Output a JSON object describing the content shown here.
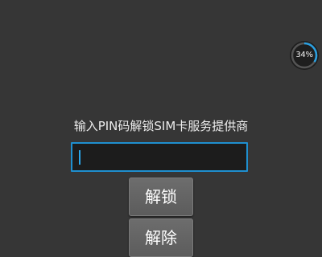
{
  "status_badge": {
    "value": "34%",
    "progress": 0.34,
    "ring_color": "#2a9fe0",
    "track_color": "#555555"
  },
  "pin_prompt": {
    "text": "输入PIN码解锁SIM卡服务提供商"
  },
  "pin_input": {
    "value": "",
    "placeholder": "",
    "border_color": "#1f8fcf"
  },
  "buttons": {
    "unlock_label": "解锁",
    "dismiss_label": "解除"
  }
}
